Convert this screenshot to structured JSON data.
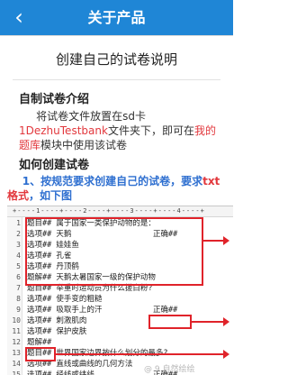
{
  "header": {
    "title": "关于产品",
    "back_icon": "chevron-left-icon"
  },
  "doc_title": "创建自己的试卷说明",
  "sections": {
    "intro_title": "自制试卷介绍",
    "intro_text_1": "将试卷文件放置在sd卡",
    "intro_path": "1DezhuTestbank",
    "intro_text_2": "文件夹下，即可在",
    "intro_link": "我的题库",
    "intro_text_3": "模块中使用该试卷",
    "create_title": "如何创建试卷",
    "step1_text": "1、按规范要求创建自己的试卷，要求",
    "step1_red": "txt格式",
    "step1_tail": "，如下图"
  },
  "editor": {
    "ruler": "+----1----+----2----+----3----+----4----+",
    "lines": [
      {
        "n": "1",
        "text": "题目##  属于国家一类保护动物的是：",
        "ans": ""
      },
      {
        "n": "2",
        "text": "选项##  天鹅",
        "ans": "正确##"
      },
      {
        "n": "3",
        "text": "选项##  娃娃鱼",
        "ans": ""
      },
      {
        "n": "4",
        "text": "选项##  孔雀",
        "ans": ""
      },
      {
        "n": "5",
        "text": "选项##  丹顶鹤",
        "ans": ""
      },
      {
        "n": "6",
        "text": "题解##  天鹅太暑国家一级的保护动物",
        "ans": ""
      },
      {
        "n": "7",
        "text": "题目##  举重时运动员为什么搓白粉?",
        "ans": ""
      },
      {
        "n": "8",
        "text": "选项##  使手变的粗糙",
        "ans": ""
      },
      {
        "n": "9",
        "text": "选项##  吸取手上的汗",
        "ans": "正确##"
      },
      {
        "n": "10",
        "text": "选项##  刺激肌肉",
        "ans": ""
      },
      {
        "n": "11",
        "text": "选项##  保护皮肤",
        "ans": ""
      },
      {
        "n": "12",
        "text": "题解##",
        "ans": ""
      },
      {
        "n": "13",
        "text": "题目##  世界国家边界按什么划分的最多?",
        "ans": ""
      },
      {
        "n": "14",
        "text": "选项##  直线或曲线的几何方法",
        "ans": ""
      },
      {
        "n": "15",
        "text": "选项##  经线或纬线",
        "ans": "正确##"
      },
      {
        "n": "16",
        "text": "选项##  河流",
        "ans": ""
      }
    ]
  },
  "watermark": "@ 9 自然绘绘"
}
